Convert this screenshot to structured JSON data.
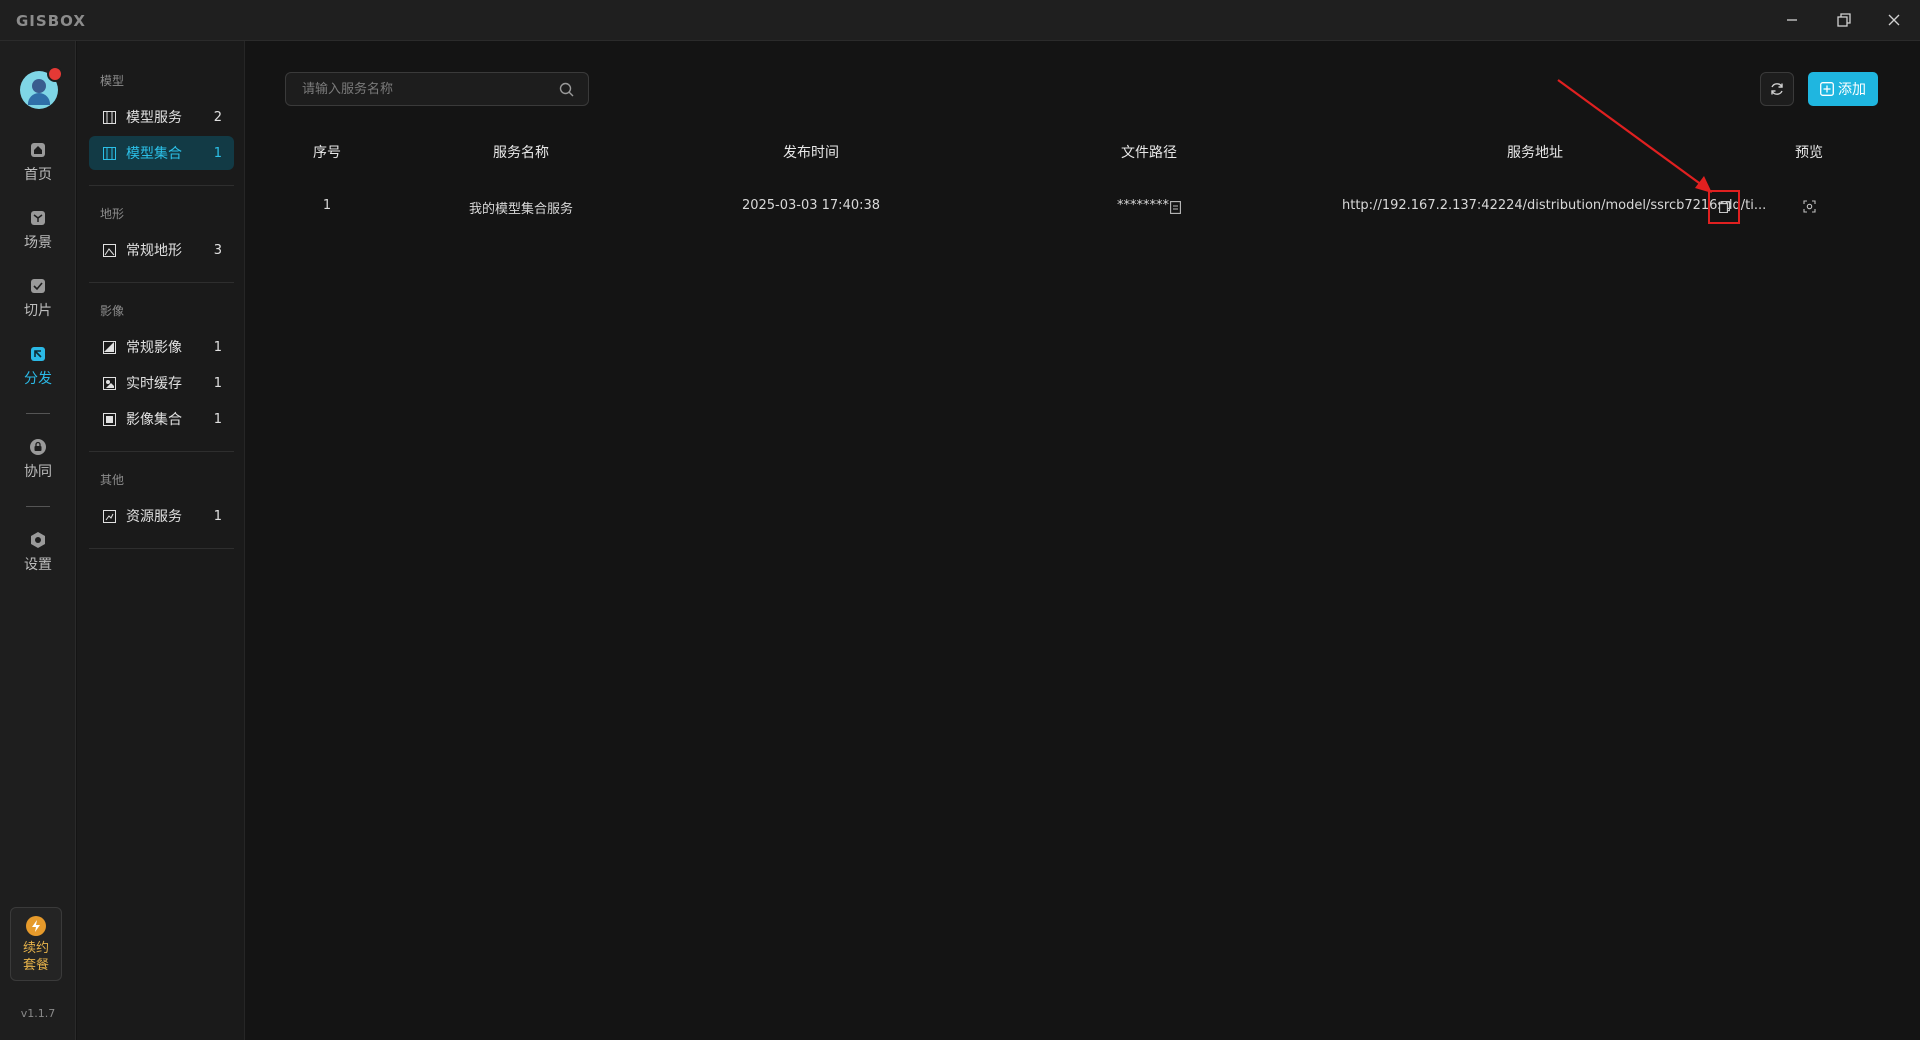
{
  "app": {
    "logo": "GISBOX",
    "version": "v1.1.7"
  },
  "rail": {
    "items": [
      {
        "label": "首页",
        "icon": "home-icon"
      },
      {
        "label": "场景",
        "icon": "scene-icon"
      },
      {
        "label": "切片",
        "icon": "slice-icon"
      },
      {
        "label": "分发",
        "icon": "distribute-icon",
        "active": true
      },
      {
        "label": "协同",
        "icon": "lock-icon"
      },
      {
        "label": "设置",
        "icon": "settings-icon"
      }
    ],
    "renew_line1": "续约",
    "renew_line2": "套餐"
  },
  "sidebar": {
    "groups": [
      {
        "title": "模型",
        "items": [
          {
            "label": "模型服务",
            "count": "2"
          },
          {
            "label": "模型集合",
            "count": "1",
            "active": true
          }
        ]
      },
      {
        "title": "地形",
        "items": [
          {
            "label": "常规地形",
            "count": "3"
          }
        ]
      },
      {
        "title": "影像",
        "items": [
          {
            "label": "常规影像",
            "count": "1"
          },
          {
            "label": "实时缓存",
            "count": "1"
          },
          {
            "label": "影像集合",
            "count": "1"
          }
        ]
      },
      {
        "title": "其他",
        "items": [
          {
            "label": "资源服务",
            "count": "1"
          }
        ]
      }
    ]
  },
  "toolbar": {
    "search_placeholder": "请输入服务名称",
    "add_label": "添加"
  },
  "table": {
    "headers": [
      "序号",
      "服务名称",
      "发布时间",
      "文件路径",
      "服务地址",
      "预览"
    ],
    "rows": [
      {
        "index": "1",
        "name": "我的模型集合服务",
        "time": "2025-03-03 17:40:38",
        "path": "********",
        "url": "http://192.167.2.137:42224/distribution/model/ssrcb7216sdq/ti..."
      }
    ]
  },
  "colors": {
    "accent": "#1fb6e0",
    "annotation": "#e02020"
  }
}
